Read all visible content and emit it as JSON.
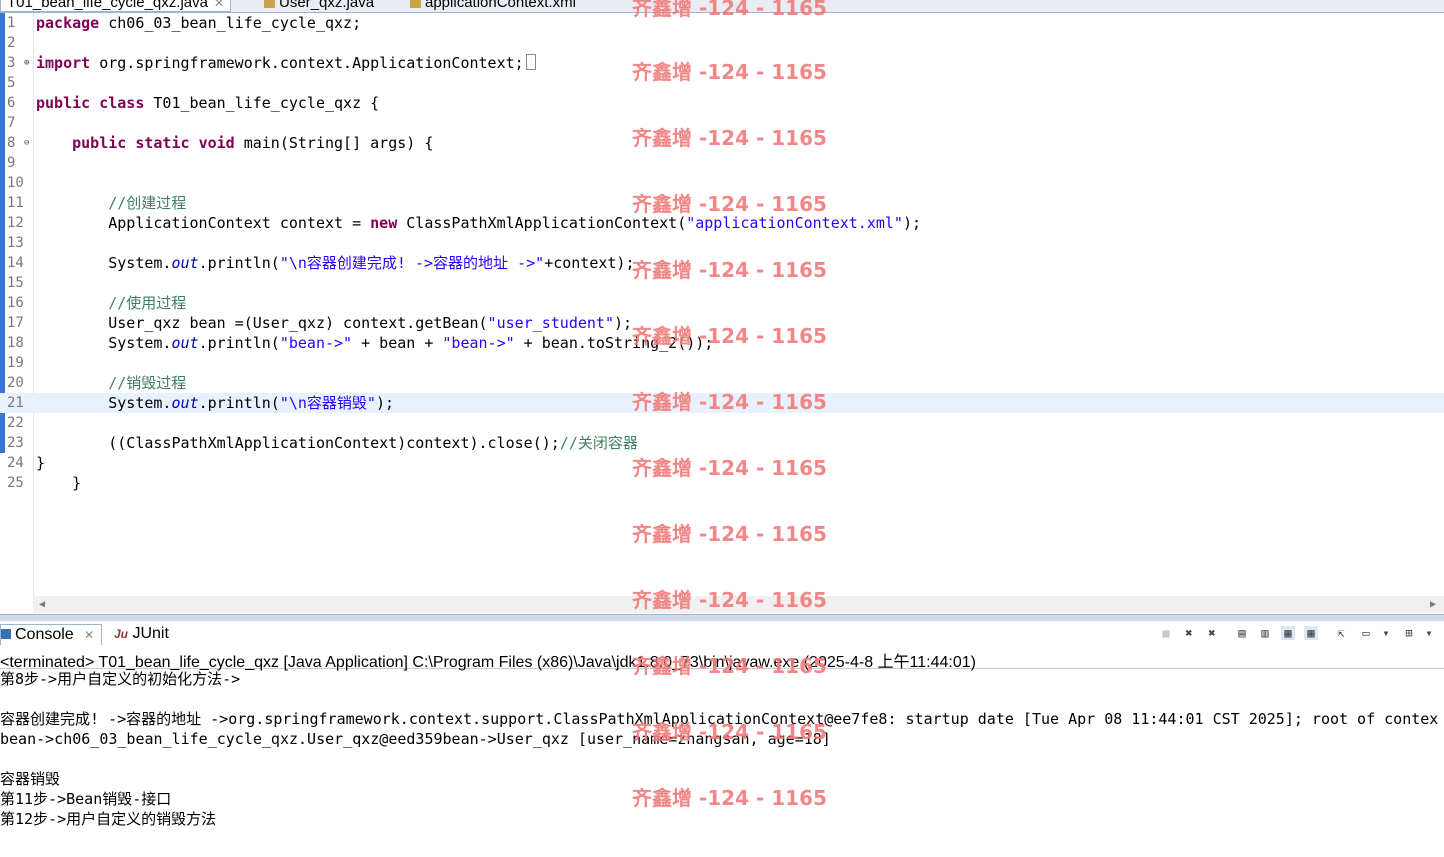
{
  "editor_tabs": [
    {
      "label": "T01_bean_life_cycle_qxz.java",
      "active": true
    },
    {
      "label": "User_qxz.java",
      "active": false
    },
    {
      "label": "applicationContext.xml",
      "active": false
    }
  ],
  "code_lines": [
    {
      "n": "1",
      "html": "<span class=\"kw\">package</span> ch06_03_bean_life_cycle_qxz;"
    },
    {
      "n": "2",
      "html": ""
    },
    {
      "n": "3",
      "fold": "⊕",
      "html": "<span class=\"kw\">import</span> org.springframework.context.ApplicationContext;<span class=\"caretbox\"></span>"
    },
    {
      "n": "5",
      "html": ""
    },
    {
      "n": "6",
      "html": "<span class=\"kw\">public</span> <span class=\"kw\">class</span> T01_bean_life_cycle_qxz {"
    },
    {
      "n": "7",
      "html": ""
    },
    {
      "n": "8",
      "fold": "⊖",
      "html": "    <span class=\"kw\">public</span> <span class=\"kw\">static</span> <span class=\"kw\">void</span> main(String[] args) {"
    },
    {
      "n": "9",
      "html": ""
    },
    {
      "n": "10",
      "html": ""
    },
    {
      "n": "11",
      "html": "        <span class=\"cmt\">//创建过程</span>"
    },
    {
      "n": "12",
      "html": "        ApplicationContext context = <span class=\"kw\">new</span> ClassPathXmlApplicationContext(<span class=\"str\">\"applicationContext.xml\"</span>);"
    },
    {
      "n": "13",
      "html": ""
    },
    {
      "n": "14",
      "html": "        System.<span class=\"fld\">out</span>.println(<span class=\"str\">\"\\n容器创建完成! ->容器的地址 ->\"</span>+context);"
    },
    {
      "n": "15",
      "html": ""
    },
    {
      "n": "16",
      "html": "        <span class=\"cmt\">//使用过程</span>"
    },
    {
      "n": "17",
      "html": "        User_qxz bean =(User_qxz) context.getBean(<span class=\"str\">\"user_student\"</span>);"
    },
    {
      "n": "18",
      "html": "        System.<span class=\"fld\">out</span>.println(<span class=\"str\">\"bean->\"</span> + bean + <span class=\"str\">\"bean->\"</span> + bean.toString_2());"
    },
    {
      "n": "19",
      "html": ""
    },
    {
      "n": "20",
      "html": "        <span class=\"cmt\">//销毁过程</span>"
    },
    {
      "n": "21",
      "current": true,
      "html": "        System.<span class=\"fld\">out</span>.println(<span class=\"str\">\"\\n容器销毁\"</span>);"
    },
    {
      "n": "22",
      "html": ""
    },
    {
      "n": "23",
      "html": "        ((ClassPathXmlApplicationContext)context).close();<span class=\"cmt\">//关闭容器</span>"
    },
    {
      "n": "24",
      "html": "}"
    },
    {
      "n": "25",
      "html": "    }"
    }
  ],
  "console_tabs": {
    "console": "Console",
    "junit": "JUnit"
  },
  "console_status": "<terminated> T01_bean_life_cycle_qxz [Java Application] C:\\Program Files (x86)\\Java\\jdk1.8.0_73\\bin\\javaw.exe (2025-4-8 上午11:44:01)",
  "console_output": [
    "第8步->用户自定义的初始化方法->",
    "",
    "容器创建完成! ->容器的地址 ->org.springframework.context.support.ClassPathXmlApplicationContext@ee7fe8: startup date [Tue Apr 08 11:44:01 CST 2025]; root of contex",
    "bean->ch06_03_bean_life_cycle_qxz.User_qxz@eed359bean->User_qxz [user_name=zhangsan, age=18]",
    "",
    "容器销毁",
    "第11步->Bean销毁-接口",
    "第12步->用户自定义的销毁方法"
  ],
  "watermark": "齐鑫增 -124 - 1165",
  "colors": {
    "keyword": "#7f0055",
    "string": "#2a00ff",
    "comment": "#3f7f5f",
    "field": "#0000c0",
    "watermark": "#f27b7b"
  }
}
